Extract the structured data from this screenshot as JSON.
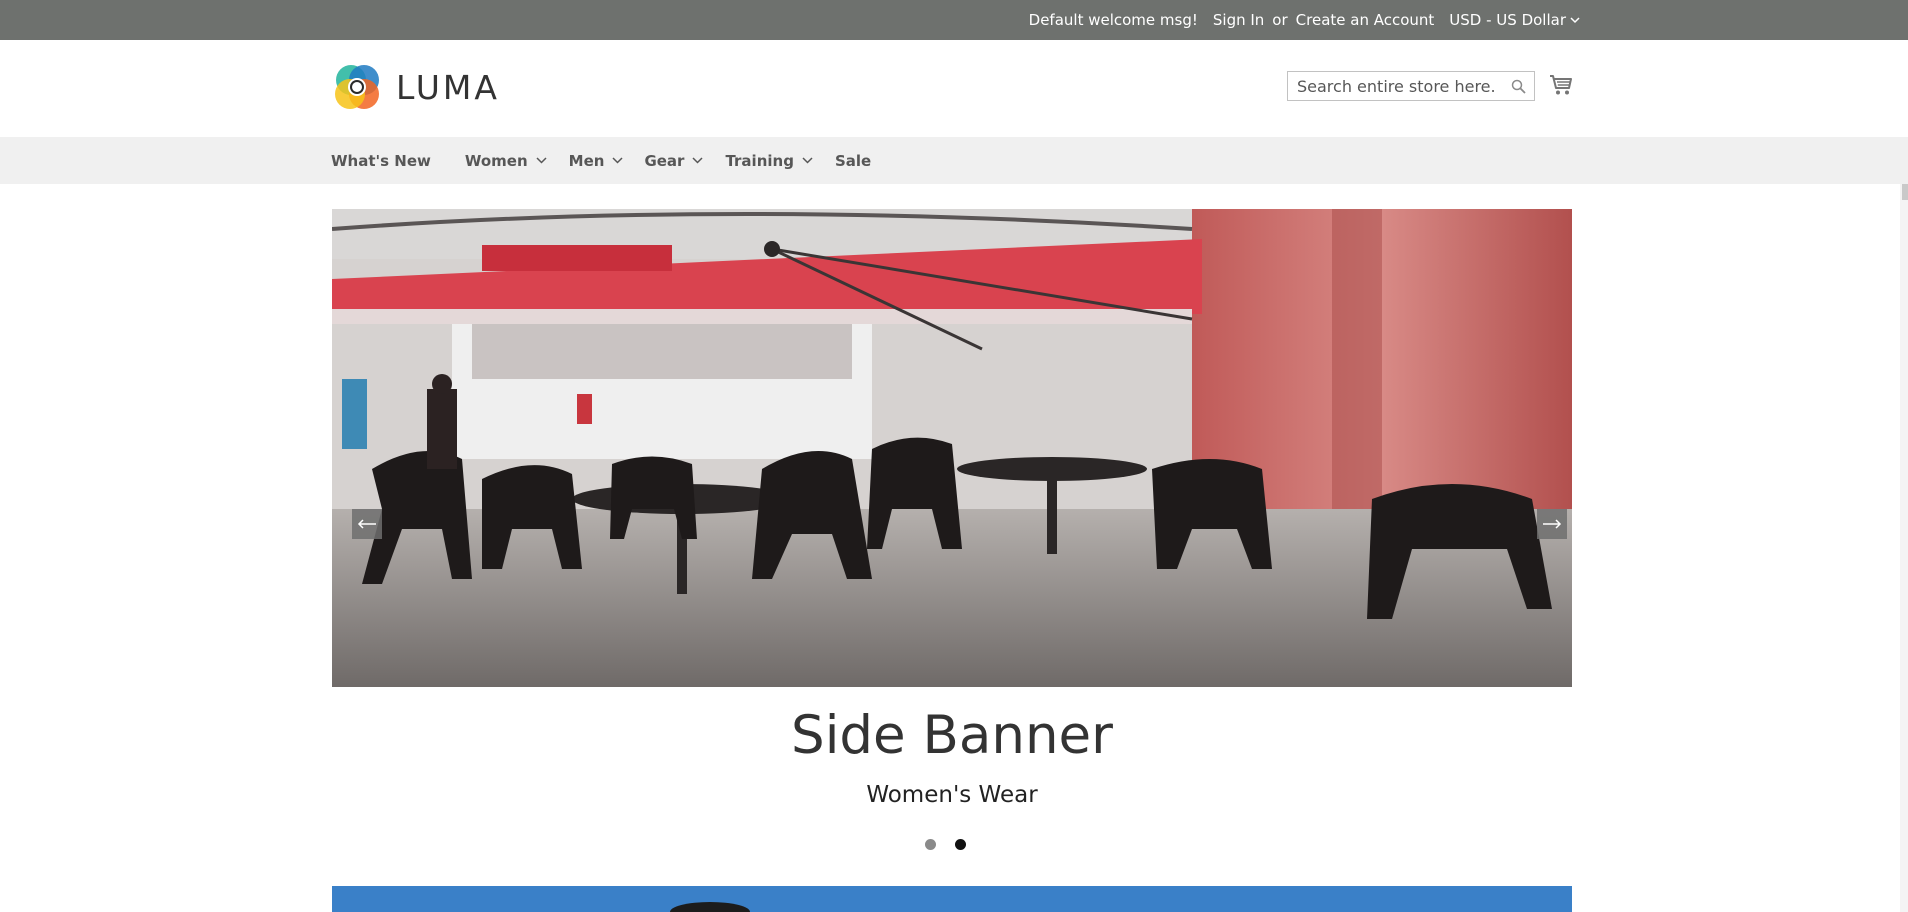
{
  "top_panel": {
    "welcome": "Default welcome msg!",
    "sign_in": "Sign In",
    "or": "or",
    "create_account": "Create an Account",
    "currency": "USD - US Dollar"
  },
  "header": {
    "logo_text": "LUMA",
    "search_placeholder": "Search entire store here...",
    "cart_icon": "cart-icon"
  },
  "nav": {
    "items": [
      {
        "label": "What's New",
        "dropdown": false
      },
      {
        "label": "Women",
        "dropdown": true
      },
      {
        "label": "Men",
        "dropdown": true
      },
      {
        "label": "Gear",
        "dropdown": true
      },
      {
        "label": "Training",
        "dropdown": true
      },
      {
        "label": "Sale",
        "dropdown": false
      }
    ]
  },
  "slider": {
    "title": "Side Banner",
    "subtitle": "Women's Wear",
    "dot_count": 2,
    "active_dot": 2,
    "prev_icon": "arrow-left-icon",
    "next_icon": "arrow-right-icon"
  },
  "colors": {
    "top_panel": "#6e716e",
    "nav_bg": "#f0f0f0",
    "umbrella_red": "#d9434f"
  }
}
